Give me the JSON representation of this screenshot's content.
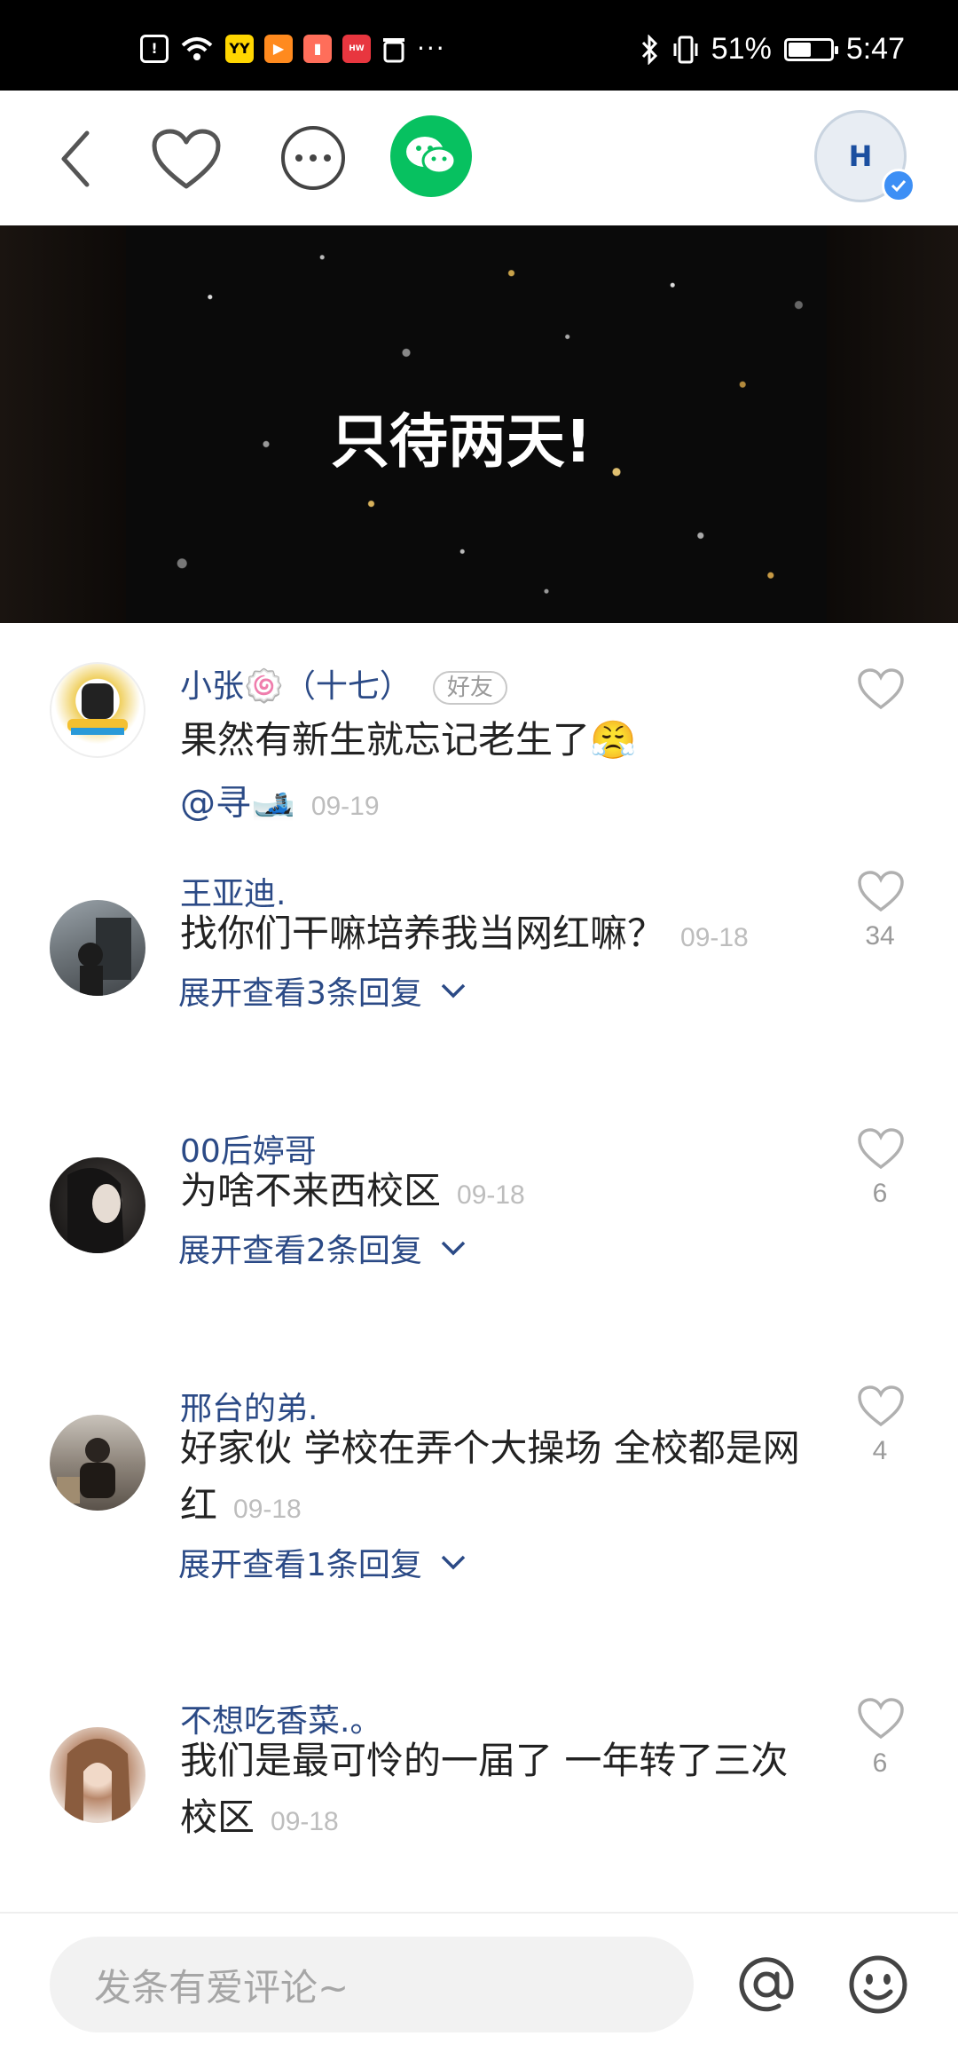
{
  "status_bar": {
    "time": "5:47",
    "battery_percent": "51%",
    "battery_level": 0.51,
    "more": "···",
    "icons": [
      "alert-icon",
      "wifi-icon",
      "yy-app-icon",
      "video-app-icon",
      "book-app-icon",
      "huawei-app-icon",
      "trash-icon",
      "bluetooth-icon",
      "vibrate-icon"
    ]
  },
  "header": {
    "icons": [
      "back-icon",
      "heart-icon",
      "more-icon",
      "wechat-icon"
    ],
    "account_avatar_text": "H"
  },
  "video": {
    "title": "只待两天!"
  },
  "comments": [
    {
      "user": "小张🍥（十七）",
      "badge": "好友",
      "text": "果然有新生就忘记老生了😤",
      "mention": "@寻🎿",
      "date": "09-19",
      "likes": "",
      "expand": ""
    },
    {
      "user": "王亚迪.",
      "text": "找你们干嘛培养我当网红嘛？",
      "date": "09-18",
      "likes": "34",
      "expand": "展开查看3条回复"
    },
    {
      "user": "00后婷哥",
      "text": "为啥不来西校区",
      "date": "09-18",
      "likes": "6",
      "expand": "展开查看2条回复"
    },
    {
      "user": "邢台的弟.",
      "text": "好家伙 学校在弄个大操场 全校都是网红",
      "date": "09-18",
      "likes": "4",
      "expand": "展开查看1条回复"
    },
    {
      "user": "不想吃香菜.。",
      "text": "我们是最可怜的一届了 一年转了三次校区",
      "date": "09-18",
      "likes": "6",
      "expand": ""
    }
  ],
  "bottom_bar": {
    "input_placeholder": "发条有爱评论~"
  },
  "colors": {
    "link_blue": "#2b4a86",
    "wechat_green": "#07c160",
    "date_gray": "#bdbdbd"
  }
}
